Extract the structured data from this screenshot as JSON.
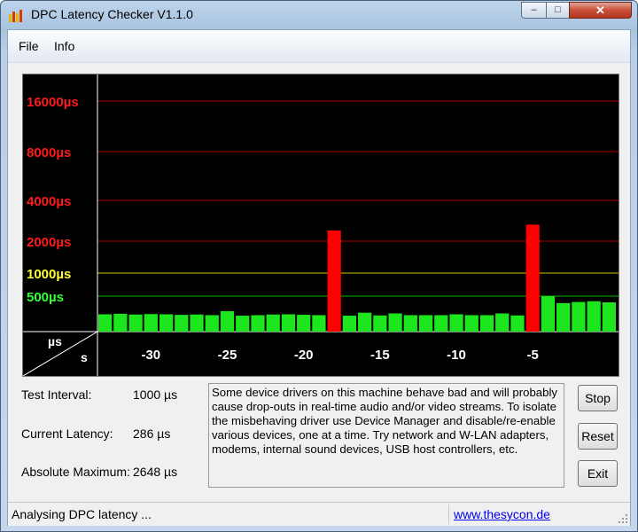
{
  "window": {
    "title": "DPC Latency Checker V1.1.0",
    "controls": {
      "minimize": "–",
      "maximize": "□",
      "close": "✕"
    }
  },
  "menu": {
    "items": [
      "File",
      "Info"
    ]
  },
  "chart_data": {
    "type": "bar",
    "y_scale": "log",
    "y_tick_labels": [
      {
        "text": "16000µs",
        "value": 16000,
        "color": "#ff1a1a"
      },
      {
        "text": "8000µs",
        "value": 8000,
        "color": "#ff1a1a"
      },
      {
        "text": "4000µs",
        "value": 4000,
        "color": "#ff1a1a"
      },
      {
        "text": "2000µs",
        "value": 2000,
        "color": "#ff1a1a"
      },
      {
        "text": "1000µs",
        "value": 1000,
        "color": "#ffff33"
      },
      {
        "text": "500µs",
        "value": 500,
        "color": "#33ff33"
      }
    ],
    "gridline_colors": {
      "red": "#b00000",
      "yellow": "#c8c800",
      "green": "#00c000"
    },
    "corner_labels": {
      "y_unit": "µs",
      "x_unit": "s"
    },
    "x_tick_labels": [
      "-30",
      "-25",
      "-20",
      "-15",
      "-10",
      "-5"
    ],
    "x_ticks": [
      -30,
      -25,
      -20,
      -15,
      -10,
      -5
    ],
    "x_range": [
      -33,
      0
    ],
    "bar_colors": {
      "ok": "#1ee61e",
      "warn": "#e6e61e",
      "bad": "#ff0000"
    },
    "bars": [
      {
        "x": -33,
        "value": 270
      },
      {
        "x": -32,
        "value": 275
      },
      {
        "x": -31,
        "value": 268
      },
      {
        "x": -30,
        "value": 272
      },
      {
        "x": -29,
        "value": 270
      },
      {
        "x": -28,
        "value": 265
      },
      {
        "x": -27,
        "value": 268
      },
      {
        "x": -26,
        "value": 262
      },
      {
        "x": -25,
        "value": 300
      },
      {
        "x": -24,
        "value": 258
      },
      {
        "x": -23,
        "value": 262
      },
      {
        "x": -22,
        "value": 268
      },
      {
        "x": -21,
        "value": 270
      },
      {
        "x": -20,
        "value": 266
      },
      {
        "x": -19,
        "value": 262
      },
      {
        "x": -18,
        "value": 2400
      },
      {
        "x": -17,
        "value": 258
      },
      {
        "x": -16,
        "value": 285
      },
      {
        "x": -15,
        "value": 260
      },
      {
        "x": -14,
        "value": 278
      },
      {
        "x": -13,
        "value": 262
      },
      {
        "x": -12,
        "value": 262
      },
      {
        "x": -11,
        "value": 262
      },
      {
        "x": -10,
        "value": 270
      },
      {
        "x": -9,
        "value": 262
      },
      {
        "x": -8,
        "value": 262
      },
      {
        "x": -7,
        "value": 278
      },
      {
        "x": -6,
        "value": 260
      },
      {
        "x": -5,
        "value": 2648
      },
      {
        "x": -4,
        "value": 500
      },
      {
        "x": -3,
        "value": 395
      },
      {
        "x": -2,
        "value": 410
      },
      {
        "x": -1,
        "value": 420
      },
      {
        "x": 0,
        "value": 405
      }
    ]
  },
  "stats": {
    "test_interval_label": "Test Interval:",
    "test_interval_value": "1000 µs",
    "current_latency_label": "Current Latency:",
    "current_latency_value": "286 µs",
    "absolute_max_label": "Absolute Maximum:",
    "absolute_max_value": "2648 µs"
  },
  "message": "Some device drivers on this machine behave bad and will probably\ncause drop-outs in real-time audio and/or video streams. To isolate\nthe misbehaving driver use Device Manager and disable/re-enable\nvarious devices, one at a time. Try network and W-LAN adapters,\nmodems, internal sound devices, USB host controllers, etc.",
  "buttons": {
    "stop": "Stop",
    "reset": "Reset",
    "exit": "Exit"
  },
  "status": {
    "text": "Analysing DPC latency ...",
    "link": "www.thesycon.de"
  }
}
